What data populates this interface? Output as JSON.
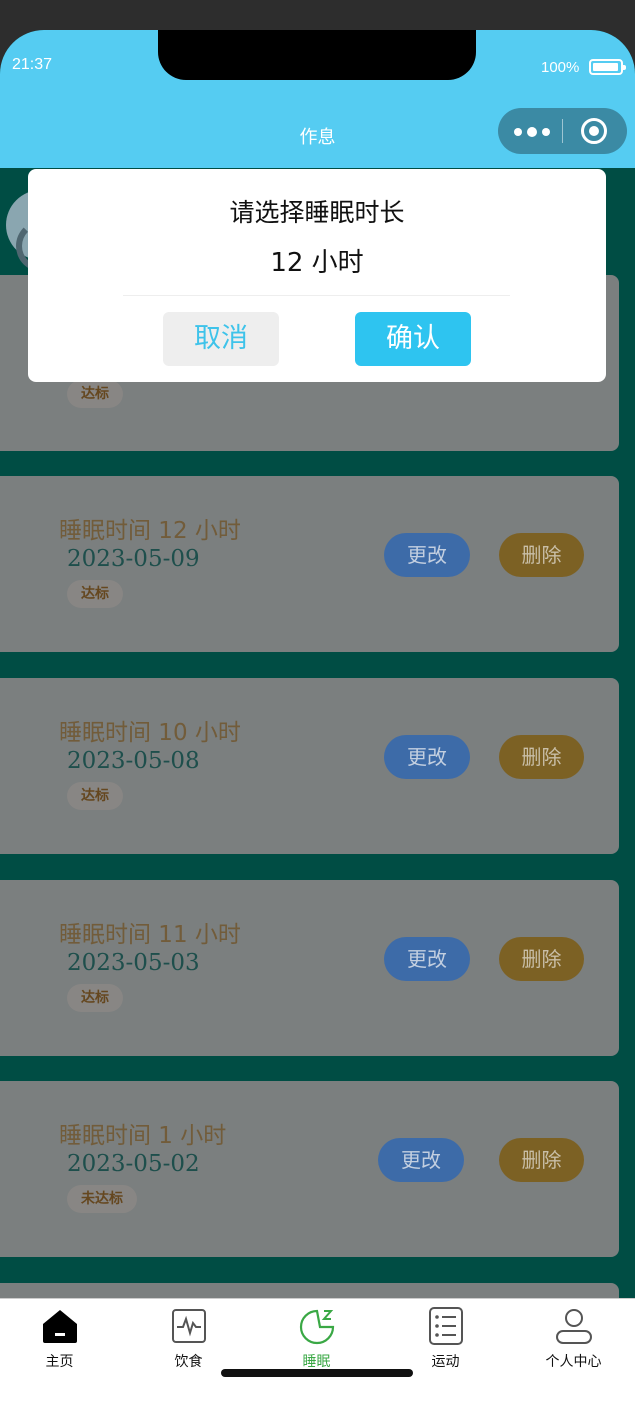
{
  "status_bar": {
    "time": "21:37",
    "battery": "100%"
  },
  "nav": {
    "title": "作息"
  },
  "dialog": {
    "title": "请选择睡眠时长",
    "value": "12 小时",
    "cancel_label": "取消",
    "confirm_label": "确认"
  },
  "records": [
    {
      "title": "",
      "date": "",
      "badge": "达标",
      "edit_label": "",
      "delete_label": ""
    },
    {
      "title": "睡眠时间 12 小时",
      "date": "2023-05-09",
      "badge": "达标",
      "edit_label": "更改",
      "delete_label": "删除"
    },
    {
      "title": "睡眠时间 10 小时",
      "date": "2023-05-08",
      "badge": "达标",
      "edit_label": "更改",
      "delete_label": "删除"
    },
    {
      "title": "睡眠时间 11 小时",
      "date": "2023-05-03",
      "badge": "达标",
      "edit_label": "更改",
      "delete_label": "删除"
    },
    {
      "title": "睡眠时间 1 小时",
      "date": "2023-05-02",
      "badge": "未达标",
      "edit_label": "更改",
      "delete_label": "删除"
    }
  ],
  "tabbar": {
    "items": [
      {
        "label": "主页",
        "icon": "home-icon"
      },
      {
        "label": "饮食",
        "icon": "pulse-icon"
      },
      {
        "label": "睡眠",
        "icon": "moon-sleep-icon"
      },
      {
        "label": "运动",
        "icon": "list-icon"
      },
      {
        "label": "个人中心",
        "icon": "person-icon"
      }
    ],
    "active_index": 2
  },
  "colors": {
    "nav_bg": "#55ccf2",
    "page_bg": "#004d44",
    "confirm_bg": "#2ec4f0",
    "active_tab": "#3aa845"
  }
}
